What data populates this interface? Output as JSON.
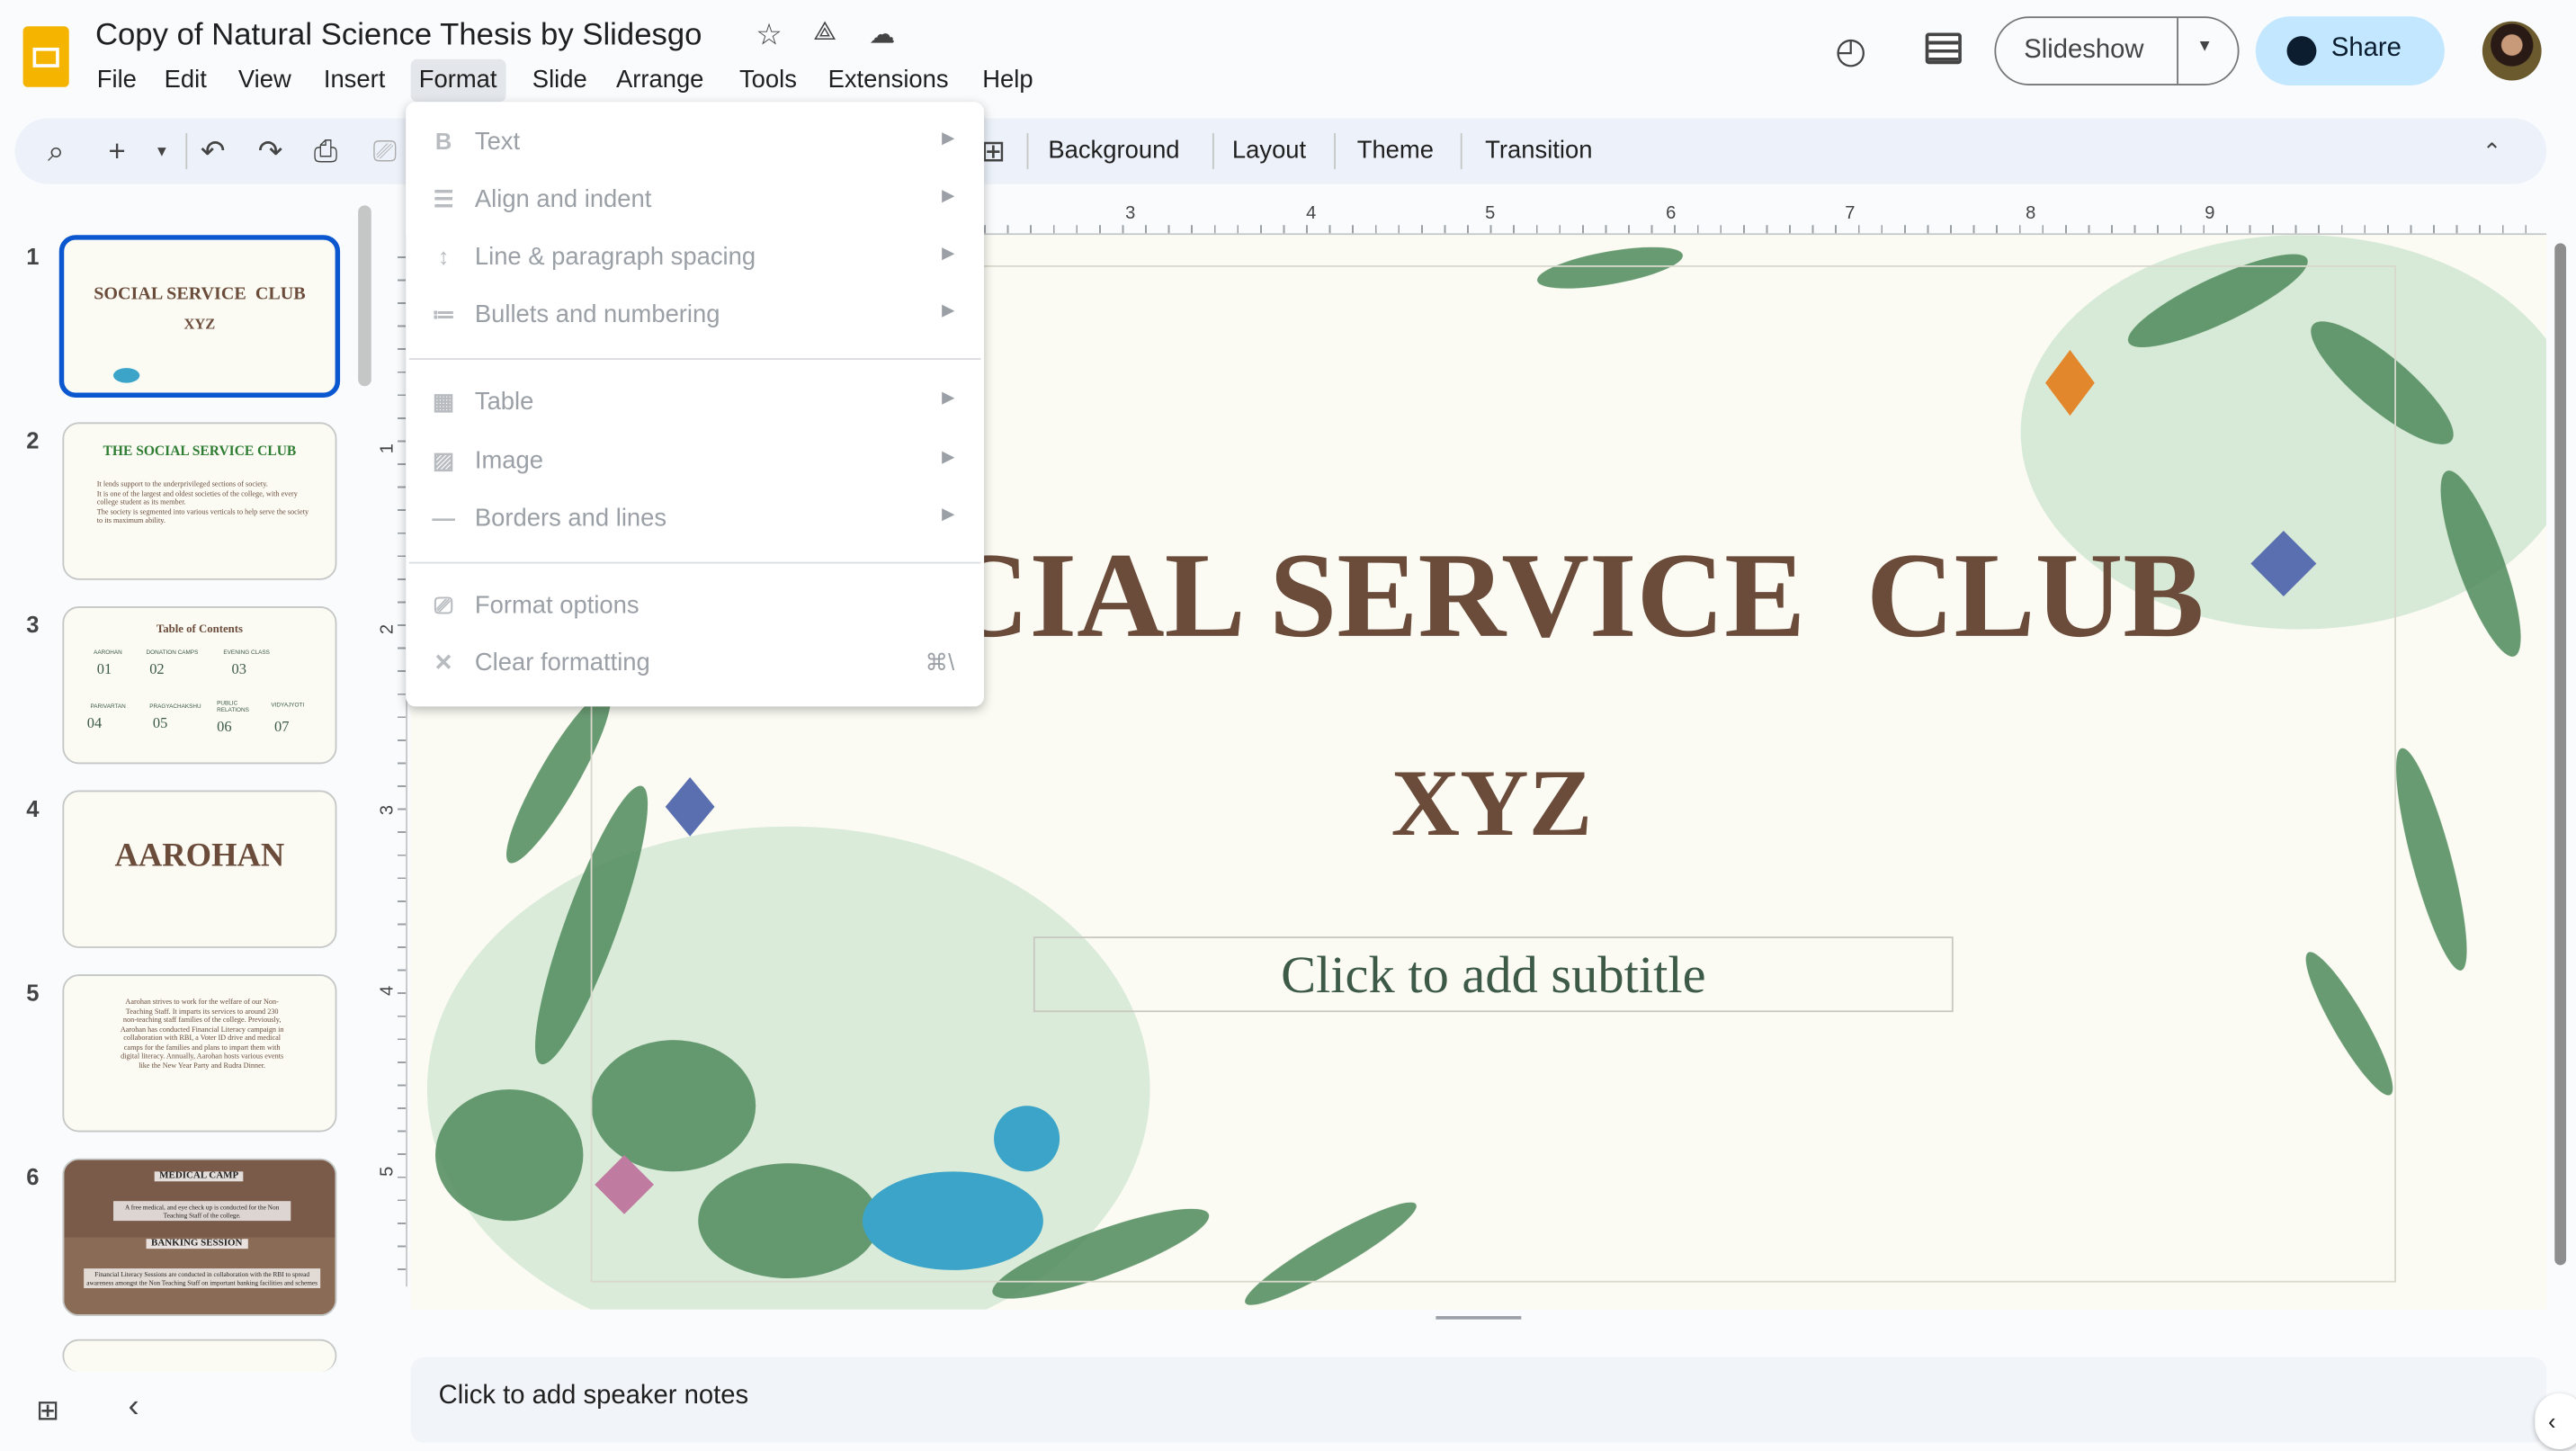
{
  "header": {
    "title": "Copy of Natural Science Thesis by Slidesgo",
    "menu": [
      "File",
      "Edit",
      "View",
      "Insert",
      "Format",
      "Slide",
      "Arrange",
      "Tools",
      "Extensions",
      "Help"
    ],
    "active_menu": "Format",
    "slideshow_label": "Slideshow",
    "share_label": "Share"
  },
  "toolbar": {
    "background": "Background",
    "layout": "Layout",
    "theme": "Theme",
    "transition": "Transition"
  },
  "format_menu": {
    "items": [
      {
        "label": "Text",
        "icon": "bold-icon",
        "submenu": true
      },
      {
        "label": "Align and indent",
        "icon": "indent-icon",
        "submenu": true
      },
      {
        "label": "Line & paragraph spacing",
        "icon": "line-spacing-icon",
        "submenu": true
      },
      {
        "label": "Bullets and numbering",
        "icon": "bullets-icon",
        "submenu": true
      },
      {
        "label": "Table",
        "icon": "table-icon",
        "submenu": true
      },
      {
        "label": "Image",
        "icon": "image-icon",
        "submenu": true
      },
      {
        "label": "Borders and lines",
        "icon": "border-line-icon",
        "submenu": true
      },
      {
        "label": "Format options",
        "icon": "format-paint-icon",
        "submenu": false
      },
      {
        "label": "Clear formatting",
        "icon": "clear-format-icon",
        "shortcut": "⌘\\"
      }
    ]
  },
  "ruler": {
    "h": [
      "3",
      "4",
      "5",
      "6",
      "7",
      "8",
      "9"
    ],
    "v": [
      "1",
      "2",
      "3",
      "4",
      "5"
    ]
  },
  "slide": {
    "title": "SOCIAL SERVICE  CLUB",
    "subtitle_line": "XYZ",
    "subtitle_placeholder": "Click to add subtitle",
    "title_color": "#6b4c3b"
  },
  "notes": {
    "placeholder": "Click to add speaker notes"
  },
  "thumbnails": [
    {
      "n": "1",
      "title": "SOCIAL SERVICE  CLUB",
      "sub": "XYZ"
    },
    {
      "n": "2",
      "title": "THE SOCIAL SERVICE CLUB",
      "bullets": [
        "It lends support to the underprivileged sections of society.",
        "It is one of the largest and oldest societies of the college, with every college student as its member.",
        "The society  is segmented into various verticals to help serve the society to its maximum ability."
      ]
    },
    {
      "n": "3",
      "title": "Table of Contents",
      "items": [
        {
          "num": "01",
          "label": "AAROHAN"
        },
        {
          "num": "02",
          "label": "DONATION CAMPS"
        },
        {
          "num": "03",
          "label": "EVENING CLASS"
        },
        {
          "num": "04",
          "label": "PARIVARTAN"
        },
        {
          "num": "05",
          "label": "PRAGYACHAKSHU"
        },
        {
          "num": "06",
          "label": "PUBLIC RELATIONS"
        },
        {
          "num": "07",
          "label": "VIDYAJYOTI"
        }
      ]
    },
    {
      "n": "4",
      "title": "AAROHAN"
    },
    {
      "n": "5",
      "body": "Aarohan strives to work for the welfare of our Non-Teaching Staff. It imparts its services to around 230 non-teaching staff families of the college. Previously, Aarohan has conducted Financial Literacy campaign in collaboration with RBI, a Voter ID drive and medical camps for the families and plans to impart them with digital literacy. Annually, Aarohan hosts various events like the New Year Party and Rudra Dinner."
    },
    {
      "n": "6",
      "h1": "MEDICAL CAMP",
      "p1": "A free medical, and eye check up is conducted for the Non Teaching Staff of the college.",
      "h2": "BANKING SESSION",
      "p2": "Financial Literacy Sessions are conducted in collaboration with the RBI to spread awareness amongst the Non Teaching Staff on important banking facilities and schemes"
    }
  ],
  "colors": {
    "accent": "#0b57d0",
    "share_bg": "#c2e7ff",
    "toolbar_bg": "#edf2fa",
    "leaf": "#4f8a5b"
  }
}
